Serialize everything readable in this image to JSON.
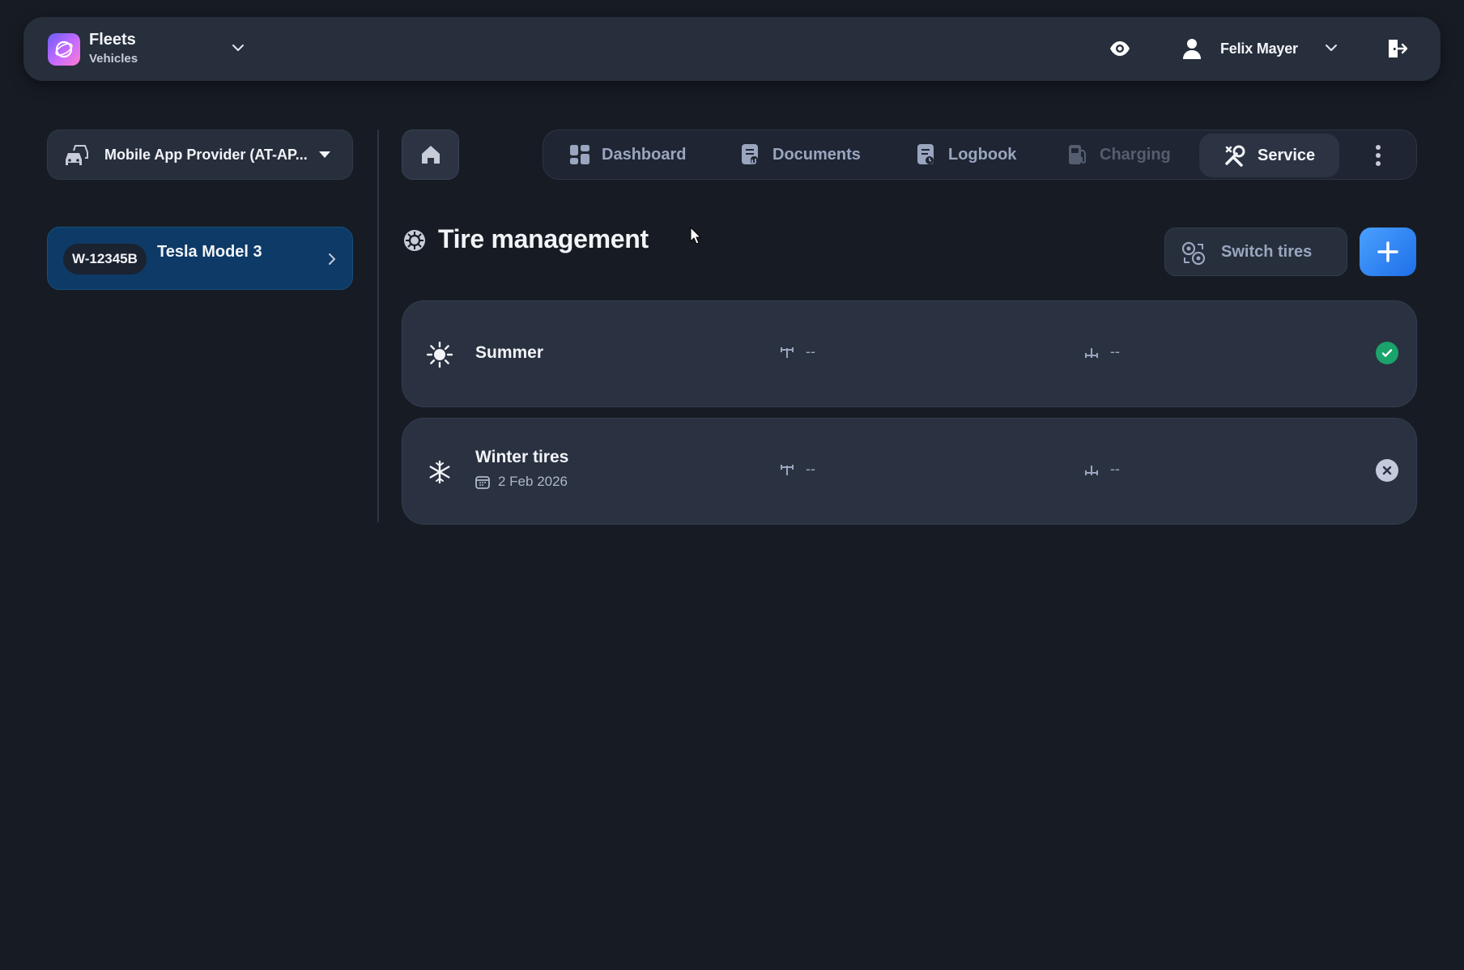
{
  "header": {
    "brand_title": "Fleets",
    "brand_subtitle": "Vehicles",
    "user_name": "Felix Mayer"
  },
  "sidebar": {
    "org_label": "Mobile App Provider (AT-AP...",
    "vehicle": {
      "plate": "W-12345B",
      "name": "Tesla Model 3"
    }
  },
  "nav": {
    "items": [
      {
        "label": "Dashboard",
        "icon": "dashboard-icon"
      },
      {
        "label": "Documents",
        "icon": "documents-icon"
      },
      {
        "label": "Logbook",
        "icon": "logbook-icon"
      },
      {
        "label": "Charging",
        "icon": "charging-icon",
        "disabled": true
      },
      {
        "label": "Service",
        "icon": "service-icon",
        "active": true
      }
    ]
  },
  "page": {
    "title": "Tire management",
    "switch_label": "Switch tires"
  },
  "tires": [
    {
      "name": "Summer",
      "icon": "sun-icon",
      "date": "",
      "metric_a": "--",
      "metric_b": "--",
      "status": "active"
    },
    {
      "name": "Winter tires",
      "icon": "snowflake-icon",
      "date": "2 Feb 2026",
      "metric_a": "--",
      "metric_b": "--",
      "status": "inactive"
    }
  ],
  "colors": {
    "background": "#171c24",
    "surface": "#272e3c",
    "accent": "#2f84f5",
    "selected_vehicle": "#0d3a66",
    "status_ok": "#1aa36a"
  }
}
